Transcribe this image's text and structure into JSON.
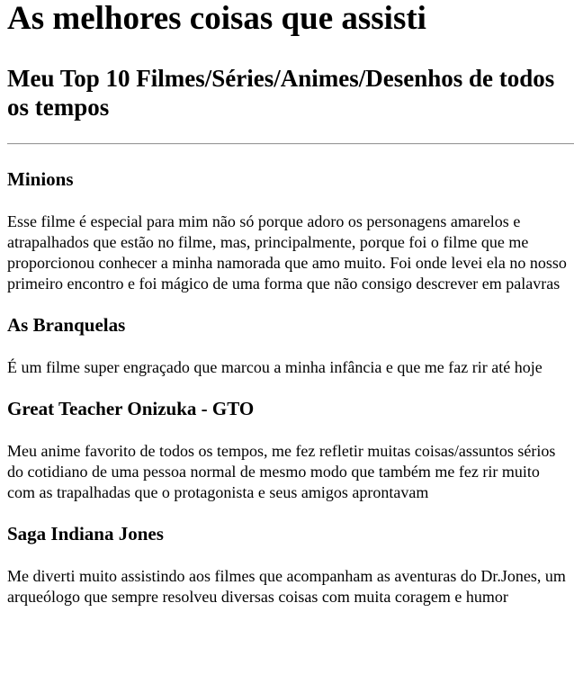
{
  "page": {
    "title": "As melhores coisas que assisti",
    "subtitle": "Meu Top 10 Filmes/Séries/Animes/Desenhos de todos os tempos"
  },
  "items": [
    {
      "name": "Minions",
      "description": "Esse filme é especial para mim não só porque adoro os personagens amarelos e atrapalhados que estão no filme, mas, principalmente, porque foi o filme que me proporcionou conhecer a minha namorada que amo muito. Foi onde levei ela no nosso primeiro encontro e foi mágico de uma forma que não consigo descrever em palavras"
    },
    {
      "name": "As Branquelas",
      "description": "É um filme super engraçado que marcou a minha infância e que me faz rir até hoje"
    },
    {
      "name": "Great Teacher Onizuka - GTO",
      "description": "Meu anime favorito de todos os tempos, me fez refletir muitas coisas/assuntos sérios do cotidiano de uma pessoa normal de mesmo modo que também me fez rir muito com as trapalhadas que o protagonista e seus amigos aprontavam"
    },
    {
      "name": "Saga Indiana Jones",
      "description": "Me diverti muito assistindo aos filmes que acompanham as aventuras do Dr.Jones, um arqueólogo que sempre resolveu diversas coisas com muita coragem e humor"
    }
  ]
}
